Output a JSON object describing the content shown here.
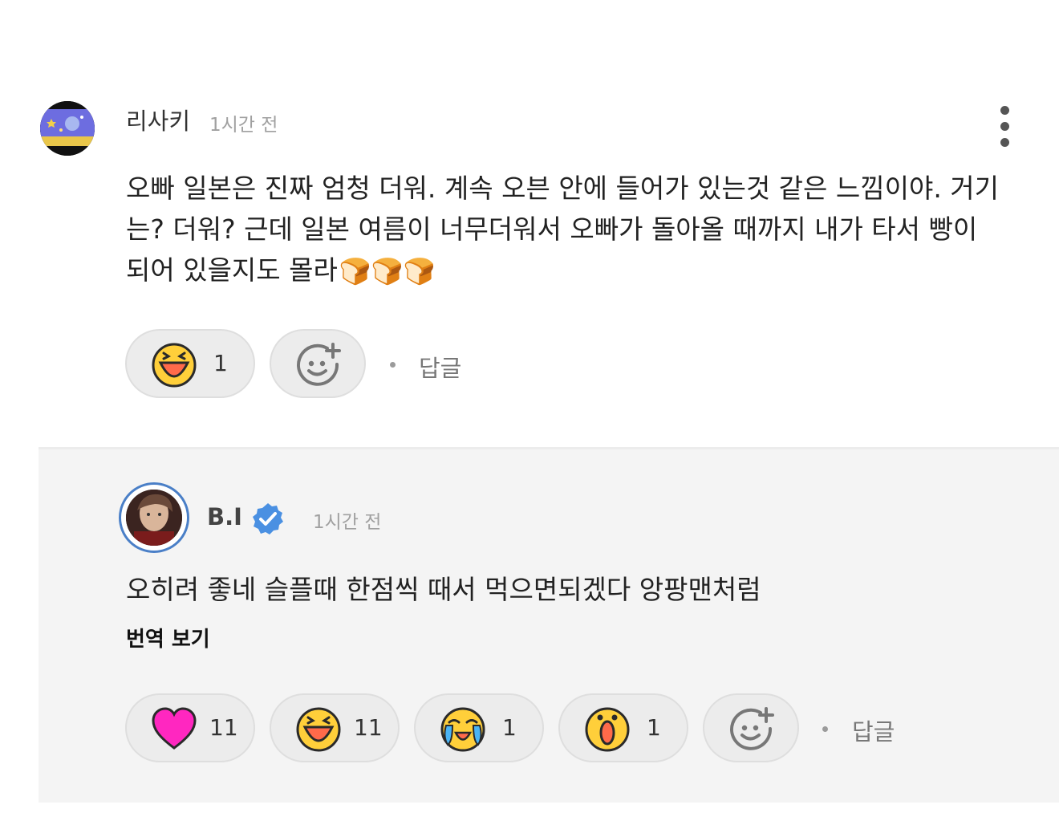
{
  "comment": {
    "author": "리사키",
    "time": "1시간 전",
    "text_lines": [
      "오빠 일본은 진짜 엄청 더워. 계속 오븐 안에 들어가 있는것 같은 느낌이야. 거기",
      "는? 더워? 근데 일본 여름이 너무더워서 오빠가 돌아올 때까지 내가 타서 빵이",
      "되어 있을지도 몰라"
    ],
    "emoji": "🍞🍞🍞",
    "reaction_laugh_count": "1",
    "reply_label": "답글"
  },
  "reply": {
    "author": "B.I",
    "verified": true,
    "time": "1시간 전",
    "text": "오히려 좋네 슬플때 한점씩 때서 먹으면되겠다 앙팡맨처럼",
    "translate_label": "번역 보기",
    "reactions": [
      {
        "name": "heart",
        "count": "11"
      },
      {
        "name": "laugh",
        "count": "11"
      },
      {
        "name": "cry",
        "count": "1"
      },
      {
        "name": "surprise",
        "count": "1"
      }
    ],
    "reply_label": "답글"
  },
  "colors": {
    "heart": "#ff27c0",
    "emoji_yellow": "#ffd23a",
    "verified_blue": "#4a90e2",
    "avatar_ring": "#4a7fc7"
  }
}
